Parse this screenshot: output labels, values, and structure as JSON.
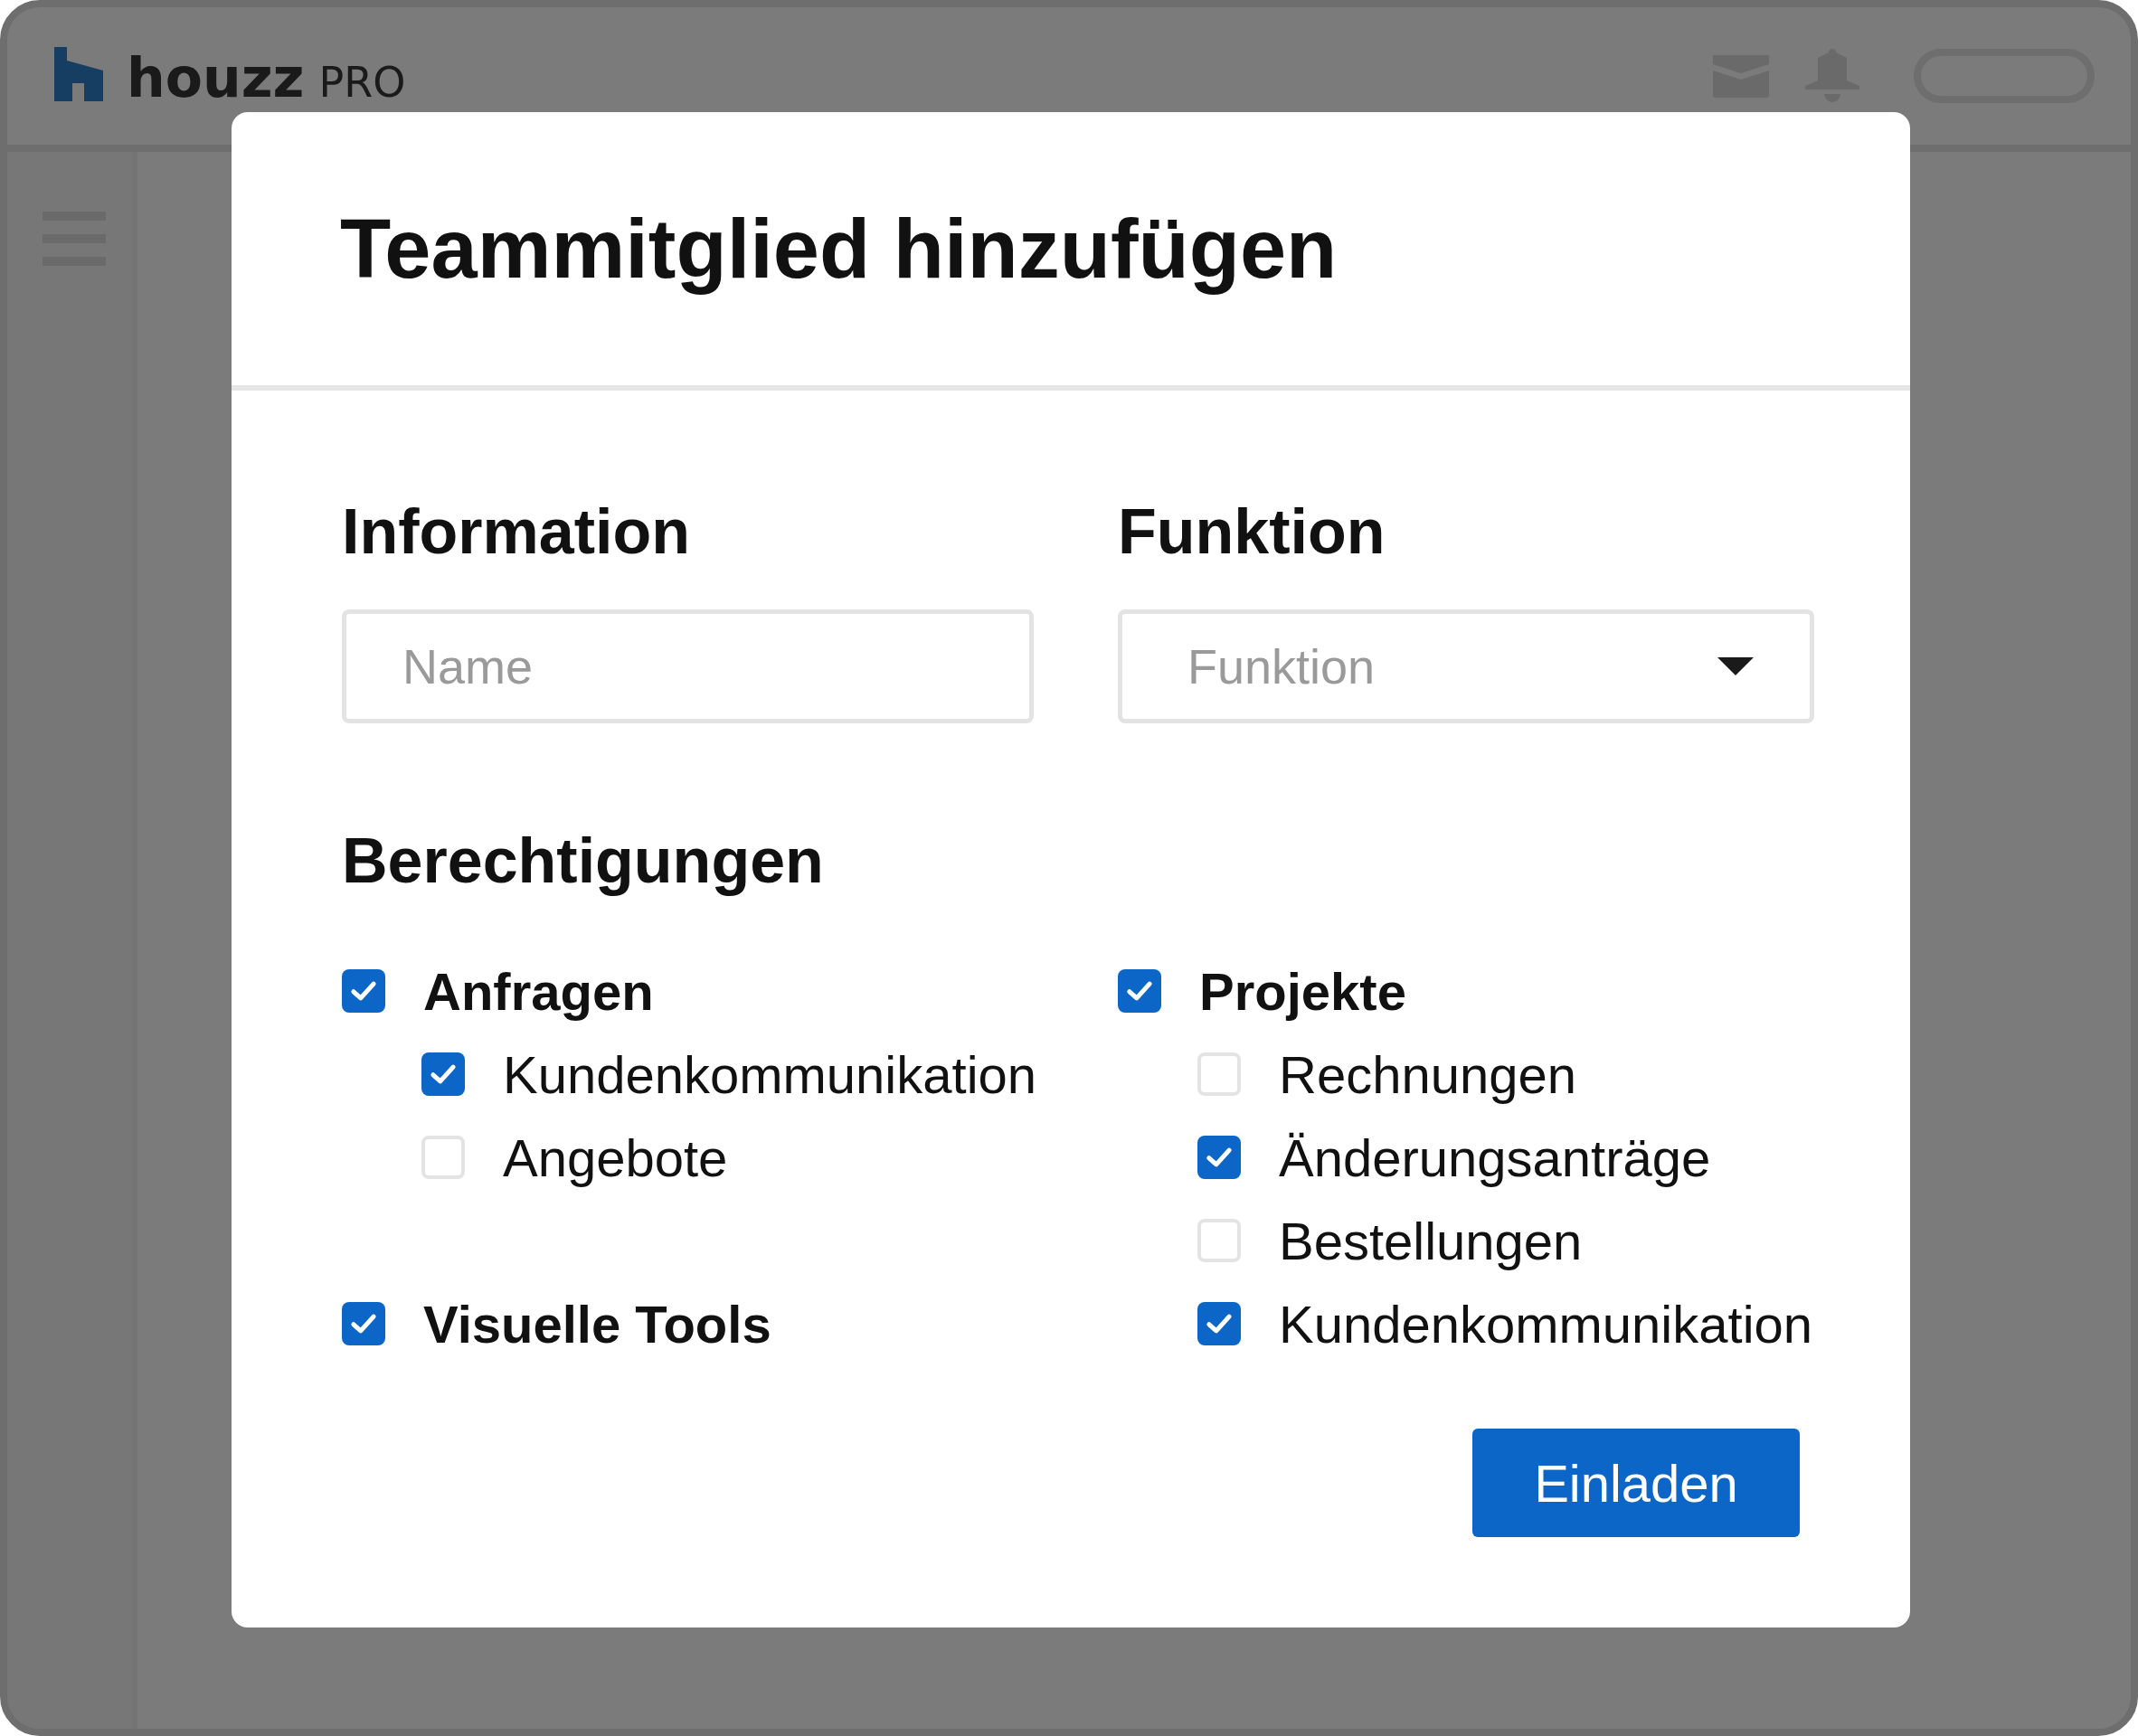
{
  "app_header": {
    "logo_text": "houzz",
    "logo_suffix": "PRO"
  },
  "modal": {
    "title": "Teammitglied hinzufügen",
    "information": {
      "heading": "Information",
      "name_field": {
        "placeholder": "Name"
      }
    },
    "function": {
      "heading": "Funktion",
      "select": {
        "placeholder": "Funktion"
      }
    },
    "permissions": {
      "heading": "Berechtigungen",
      "columns": [
        [
          {
            "label": "Anfragen",
            "checked": true,
            "children": [
              {
                "label": "Kundenkommunikation",
                "checked": true
              },
              {
                "label": "Angebote",
                "checked": false
              }
            ]
          },
          {
            "label": "Visuelle Tools",
            "checked": true
          }
        ],
        [
          {
            "label": "Projekte",
            "checked": true,
            "children": [
              {
                "label": "Rechnungen",
                "checked": false
              },
              {
                "label": "Änderungsanträge",
                "checked": true
              },
              {
                "label": "Bestellungen",
                "checked": false
              },
              {
                "label": "Kundenkommunikation",
                "checked": true
              }
            ]
          }
        ]
      ]
    },
    "submit_button": "Einladen"
  }
}
